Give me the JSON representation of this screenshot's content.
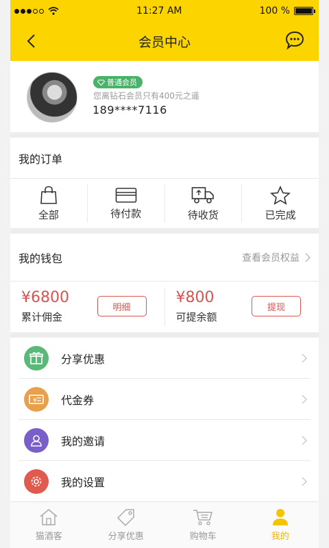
{
  "status": {
    "time": "11:27 AM",
    "battery": "100 %",
    "battery_level": 1.0
  },
  "nav": {
    "title": "会员中心",
    "back_icon": "chevron-left-icon",
    "right_icon": "chat-bubble-icon"
  },
  "profile": {
    "badge": "普通会员",
    "hint": "您离钻石会员只有400元之遥",
    "phone": "189****7116"
  },
  "orders": {
    "title": "我的订单",
    "items": [
      {
        "label": "全部",
        "icon": "shopping-bag-icon"
      },
      {
        "label": "待付款",
        "icon": "card-icon"
      },
      {
        "label": "待收货",
        "icon": "truck-icon"
      },
      {
        "label": "已完成",
        "icon": "star-icon"
      }
    ]
  },
  "wallet": {
    "title": "我的钱包",
    "link": "查看会员权益",
    "cells": [
      {
        "amount": "¥6800",
        "label": "累计佣金",
        "button": "明细"
      },
      {
        "amount": "¥800",
        "label": "可提余额",
        "button": "提现"
      }
    ]
  },
  "menu": [
    {
      "label": "分享优惠",
      "icon": "gift-icon",
      "color": "#5ab878"
    },
    {
      "label": "代金券",
      "icon": "voucher-icon",
      "color": "#e8a04a"
    },
    {
      "label": "我的邀请",
      "icon": "person-icon",
      "color": "#7a5ec9"
    },
    {
      "label": "我的设置",
      "icon": "gear-icon",
      "color": "#e05a4e"
    }
  ],
  "tabs": [
    {
      "label": "猫酒客",
      "icon": "home-icon"
    },
    {
      "label": "分享优惠",
      "icon": "tag-icon"
    },
    {
      "label": "购物车",
      "icon": "cart-icon"
    },
    {
      "label": "我的",
      "icon": "user-icon"
    }
  ],
  "colors": {
    "brand": "#fcd400",
    "accent": "#d9534f",
    "active_tab": "#f0b400"
  }
}
